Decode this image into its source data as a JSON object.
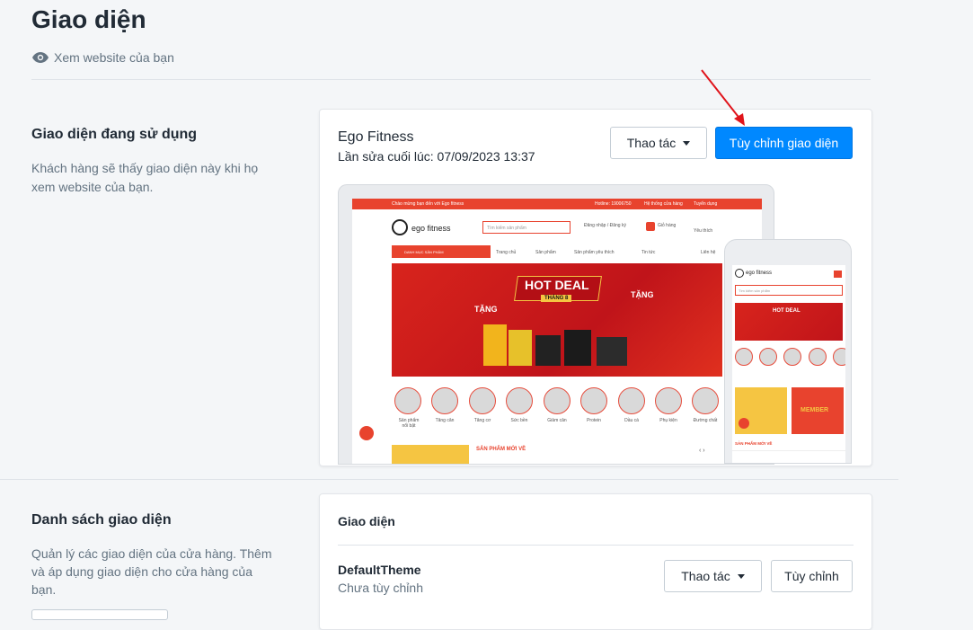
{
  "header": {
    "title": "Giao diện",
    "view_link": "Xem website của bạn",
    "eye_icon": "eye-icon"
  },
  "current_section": {
    "title": "Giao diện đang sử dụng",
    "description": "Khách hàng sẽ thấy giao diện này khi họ xem website của bạn.",
    "theme_name": "Ego Fitness",
    "last_edited": "Lần sửa cuối lúc: 07/09/2023 13:37",
    "actions_label": "Thao tác",
    "customize_label": "Tùy chỉnh giao diện"
  },
  "preview": {
    "topbar_left": "Chào mừng bạn đến với Ego fitness",
    "topbar_hotline": "Hotline: 19006750",
    "topbar_system": "Hệ thống cửa hàng",
    "topbar_recruit": "Tuyển dụng",
    "logo_text": "ego fitness",
    "search_placeholder": "Tìm kiếm sản phẩm",
    "login_text": "Đăng nhập / Đăng ký",
    "cart_text": "Giỏ hàng",
    "fav_text": "Yêu thích",
    "category_menu": "DANH MỤC SẢN PHẨM",
    "nav": [
      "Trang chủ",
      "Sản phẩm",
      "Sản phẩm yêu thích",
      "Tin tức",
      "Liên hệ"
    ],
    "banner_title": "HOT DEAL",
    "banner_sub": "THÁNG 8",
    "banner_gift": "TẶNG",
    "categories": [
      "Sản phẩm nổi bật",
      "Tăng cân",
      "Tăng cơ",
      "Sức bền",
      "Giảm cân",
      "Protein",
      "Dầu cá",
      "Phụ kiện",
      "Đường chất"
    ],
    "new_products": "SẢN PHẨM MỚI VỀ",
    "mobile_new_products": "SẢN PHẨM MỚI VỀ",
    "mobile_banner": "MEMBER"
  },
  "list_section": {
    "title": "Danh sách giao diện",
    "description": "Quản lý các giao diện của cửa hàng. Thêm và áp dụng giao diện cho cửa hàng của bạn.",
    "card_title": "Giao diện",
    "theme_name": "DefaultTheme",
    "theme_status": "Chưa tùy chỉnh",
    "actions_label": "Thao tác",
    "customize_label": "Tùy chỉnh"
  },
  "colors": {
    "primary": "#0088ff",
    "brand_red": "#e8432e",
    "annotation_arrow": "#e0141b"
  }
}
